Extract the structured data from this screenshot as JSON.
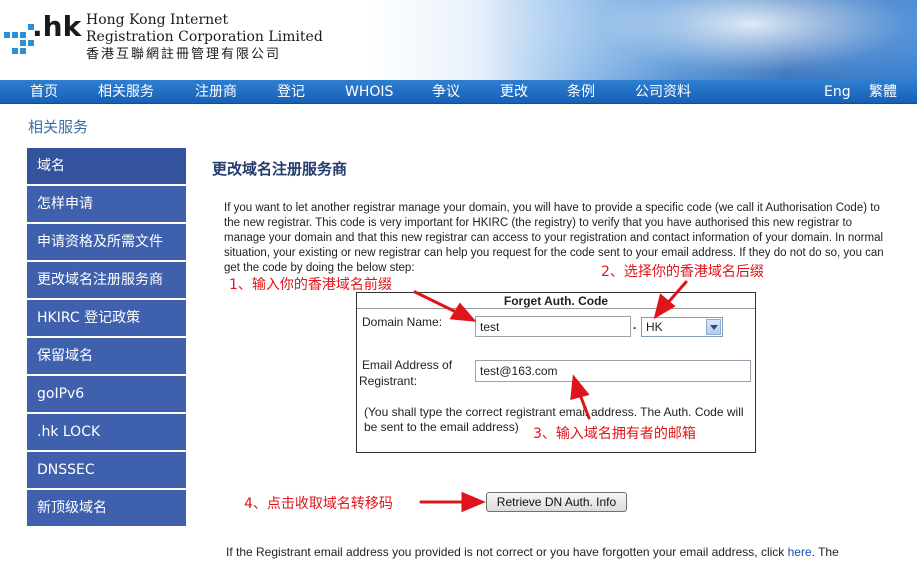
{
  "header": {
    "logo_text": ".hk",
    "org_en_line1": "Hong Kong Internet",
    "org_en_line2": "Registration Corporation Limited",
    "org_cn": "香港互聯網註冊管理有限公司"
  },
  "nav": {
    "items": [
      "首页",
      "相关服务",
      "注册商",
      "登记",
      "WHOIS",
      "争议",
      "更改",
      "条例",
      "公司资料"
    ],
    "lang_en": "Eng",
    "lang_tc": "繁體"
  },
  "section_title": "相关服务",
  "sidebar": {
    "items": [
      {
        "label": "域名"
      },
      {
        "label": "怎样申请"
      },
      {
        "label": "申请资格及所需文件"
      },
      {
        "label": "更改域名注册服务商"
      },
      {
        "label": "HKIRC 登记政策"
      },
      {
        "label": "保留域名"
      },
      {
        "label": "goIPv6"
      },
      {
        "label": ".hk LOCK"
      },
      {
        "label": "DNSSEC"
      },
      {
        "label": "新顶级域名"
      }
    ]
  },
  "main": {
    "title": "更改域名注册服务商",
    "intro": "If you want to let another registrar manage your domain, you will have to provide a specific code (we call it Authorisation Code) to the new registrar. This code is very important for HKIRC (the registry) to verify that you have authorised this new registrar to manage your domain and that this new registrar can access to your registration and contact information of your domain. In normal situation, your existing or new registrar can help you request for the code sent to your email address. If they do not do so, you can get the code by doing the below step:"
  },
  "form": {
    "title": "Forget Auth. Code",
    "domain_label": "Domain Name:",
    "domain_value": "test",
    "dot": ".",
    "suffix_selected": "HK",
    "email_label_line1": "Email Address of",
    "email_label_line2": "Registrant:",
    "email_value": "test@163.com",
    "note": "(You shall type the correct registrant email address. The Auth. Code will be sent to the email address)",
    "button_label": "Retrieve DN Auth. Info"
  },
  "annotations": {
    "a1": "1、输入你的香港域名前缀",
    "a2": "2、选择你的香港域名后缀",
    "a3": "3、输入域名拥有者的邮箱",
    "a4": "4、点击收取域名转移码"
  },
  "footer": {
    "text_before": "If the Registrant email address you provided is not correct or you have forgotten your email address, click ",
    "link": "here",
    "text_after": ". The"
  },
  "colors": {
    "nav_bg": "#1d68bf",
    "sidebar_bg": "#3f60ad",
    "annotation_red": "#e0141b",
    "section_title": "#3a6ea8"
  }
}
